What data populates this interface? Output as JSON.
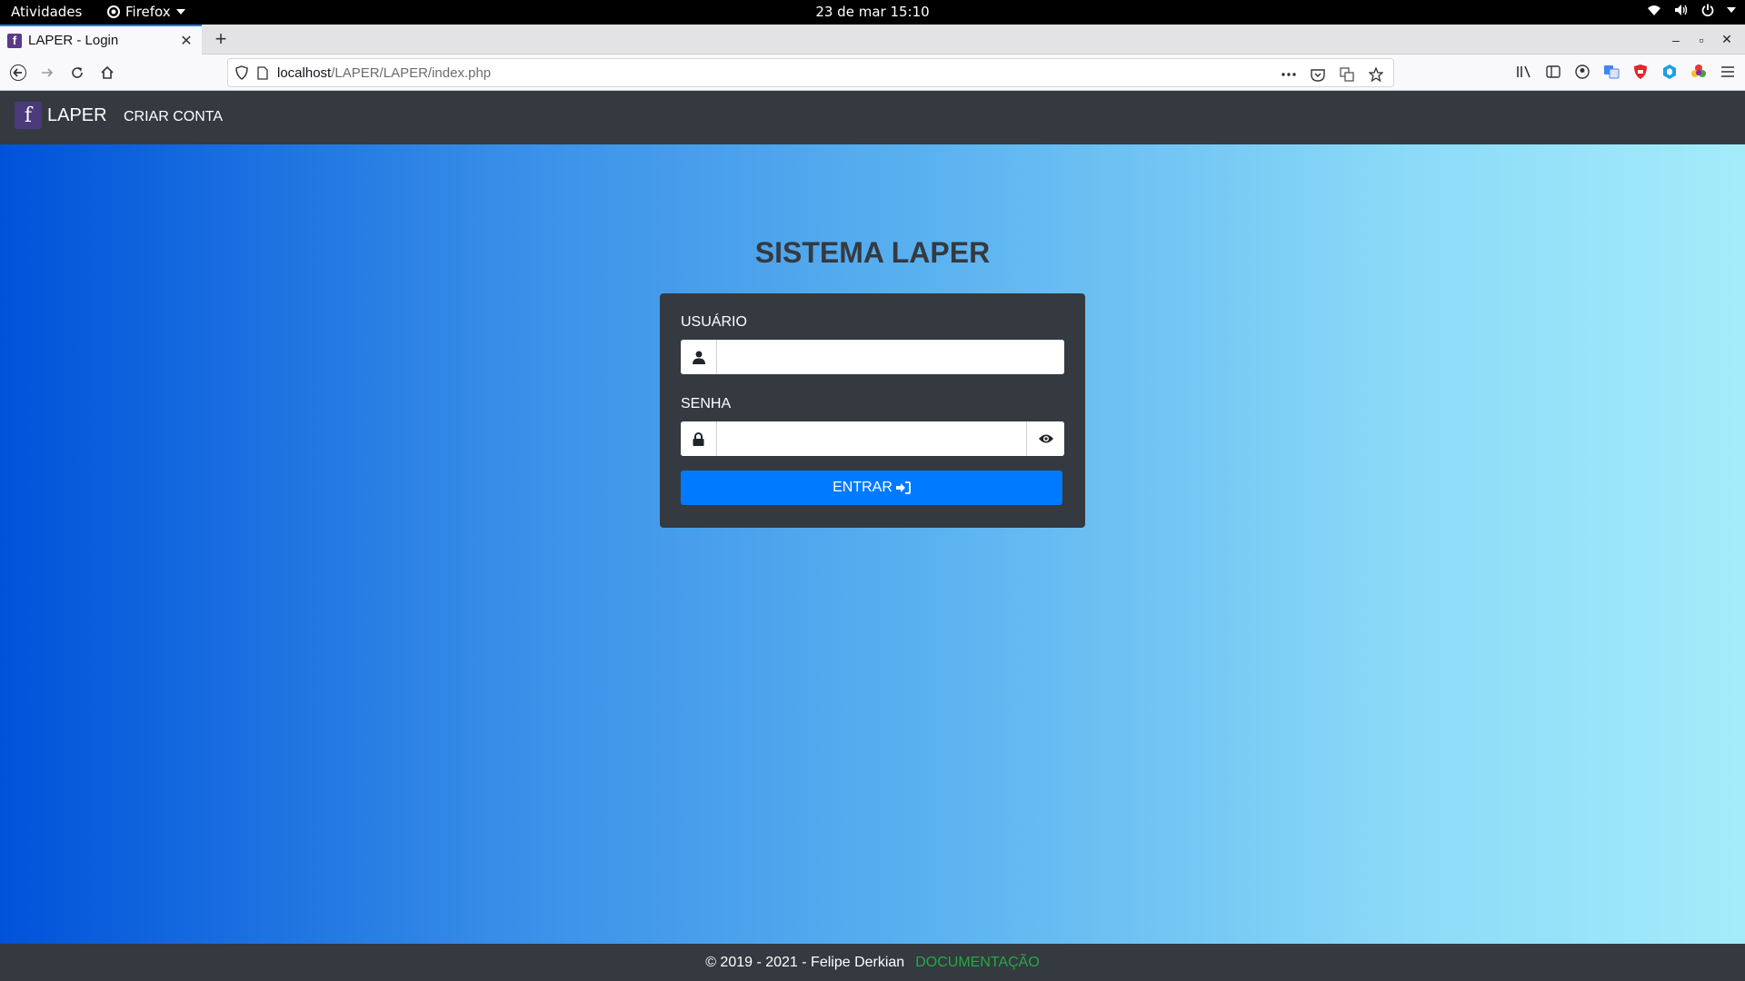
{
  "system_bar": {
    "activities": "Atividades",
    "app_name": "Firefox",
    "clock": "23 de mar  15:10"
  },
  "browser": {
    "tab_title": "LAPER - Login",
    "tab_favicon": "f",
    "new_tab": "+",
    "url_host": "localhost",
    "url_path": "/LAPER/LAPER/index.php"
  },
  "app": {
    "brand": "LAPER",
    "brand_logo": "f",
    "nav_link": "CRIAR CONTA",
    "title": "SISTEMA LAPER",
    "user_label": "USUÁRIO",
    "user_value": "",
    "password_label": "SENHA",
    "password_value": "",
    "submit_label": "ENTRAR",
    "footer_text": "© 2019 - 2021 - Felipe Derkian",
    "footer_link": "DOCUMENTAÇÃO"
  },
  "colors": {
    "navbar_bg": "#343a40",
    "primary": "#007bff",
    "link_green": "#28a745",
    "gradient_start": "#0052d9",
    "gradient_end": "#a4ecfa"
  }
}
